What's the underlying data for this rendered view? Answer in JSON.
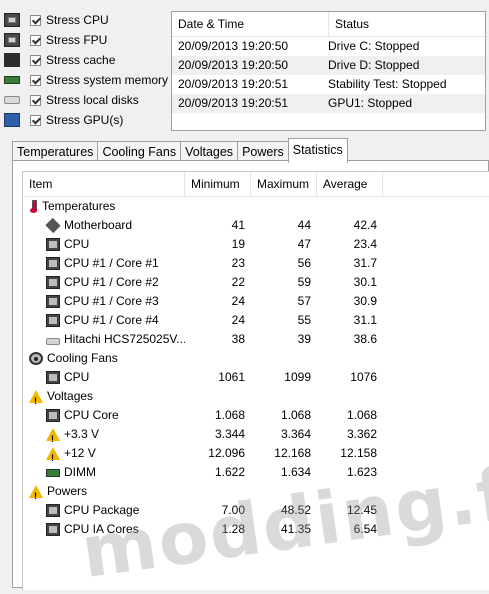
{
  "stress_options": [
    {
      "label": "Stress CPU",
      "icon": "cpu-icon",
      "checked": true
    },
    {
      "label": "Stress FPU",
      "icon": "fpu-icon",
      "checked": true
    },
    {
      "label": "Stress cache",
      "icon": "cache-icon",
      "checked": true
    },
    {
      "label": "Stress system memory",
      "icon": "memory-icon",
      "checked": true
    },
    {
      "label": "Stress local disks",
      "icon": "disk-icon",
      "checked": true
    },
    {
      "label": "Stress GPU(s)",
      "icon": "gpu-icon",
      "checked": true
    }
  ],
  "log": {
    "headers": {
      "datetime": "Date & Time",
      "status": "Status"
    },
    "rows": [
      {
        "datetime": "20/09/2013 19:20:50",
        "status": "Drive C: Stopped"
      },
      {
        "datetime": "20/09/2013 19:20:50",
        "status": "Drive D: Stopped"
      },
      {
        "datetime": "20/09/2013 19:20:51",
        "status": "Stability Test: Stopped"
      },
      {
        "datetime": "20/09/2013 19:20:51",
        "status": "GPU1: Stopped"
      }
    ]
  },
  "tabs": [
    "Temperatures",
    "Cooling Fans",
    "Voltages",
    "Powers",
    "Statistics"
  ],
  "active_tab": "Statistics",
  "stats": {
    "headers": {
      "item": "Item",
      "min": "Minimum",
      "max": "Maximum",
      "avg": "Average"
    },
    "rows": [
      {
        "kind": "group",
        "icon": "thermometer-icon",
        "item": "Temperatures"
      },
      {
        "kind": "child",
        "icon": "motherboard-icon",
        "item": "Motherboard",
        "min": "41",
        "max": "44",
        "avg": "42.4"
      },
      {
        "kind": "child",
        "icon": "chip-icon",
        "item": "CPU",
        "min": "19",
        "max": "47",
        "avg": "23.4"
      },
      {
        "kind": "child",
        "icon": "chip-icon",
        "item": "CPU #1 / Core #1",
        "min": "23",
        "max": "56",
        "avg": "31.7"
      },
      {
        "kind": "child",
        "icon": "chip-icon",
        "item": "CPU #1 / Core #2",
        "min": "22",
        "max": "59",
        "avg": "30.1"
      },
      {
        "kind": "child",
        "icon": "chip-icon",
        "item": "CPU #1 / Core #3",
        "min": "24",
        "max": "57",
        "avg": "30.9"
      },
      {
        "kind": "child",
        "icon": "chip-icon",
        "item": "CPU #1 / Core #4",
        "min": "24",
        "max": "55",
        "avg": "31.1"
      },
      {
        "kind": "child",
        "icon": "disk-icon",
        "item": "Hitachi HCS725025V...",
        "min": "38",
        "max": "39",
        "avg": "38.6"
      },
      {
        "kind": "group",
        "icon": "fan-icon",
        "item": "Cooling Fans"
      },
      {
        "kind": "child",
        "icon": "chip-icon",
        "item": "CPU",
        "min": "1061",
        "max": "1099",
        "avg": "1076"
      },
      {
        "kind": "group",
        "icon": "warning-icon",
        "item": "Voltages"
      },
      {
        "kind": "child",
        "icon": "chip-icon",
        "item": "CPU Core",
        "min": "1.068",
        "max": "1.068",
        "avg": "1.068"
      },
      {
        "kind": "child",
        "icon": "warning-icon",
        "item": "+3.3 V",
        "min": "3.344",
        "max": "3.364",
        "avg": "3.362"
      },
      {
        "kind": "child",
        "icon": "warning-icon",
        "item": "+12 V",
        "min": "12.096",
        "max": "12.168",
        "avg": "12.158"
      },
      {
        "kind": "child",
        "icon": "dimm-icon",
        "item": "DIMM",
        "min": "1.622",
        "max": "1.634",
        "avg": "1.623"
      },
      {
        "kind": "group",
        "icon": "warning-icon",
        "item": "Powers"
      },
      {
        "kind": "child",
        "icon": "chip-icon",
        "item": "CPU Package",
        "min": "7.00",
        "max": "48.52",
        "avg": "12.45"
      },
      {
        "kind": "child",
        "icon": "chip-icon",
        "item": "CPU IA Cores",
        "min": "1.28",
        "max": "41.35",
        "avg": "6.54"
      }
    ]
  },
  "watermark": "modding.fr"
}
